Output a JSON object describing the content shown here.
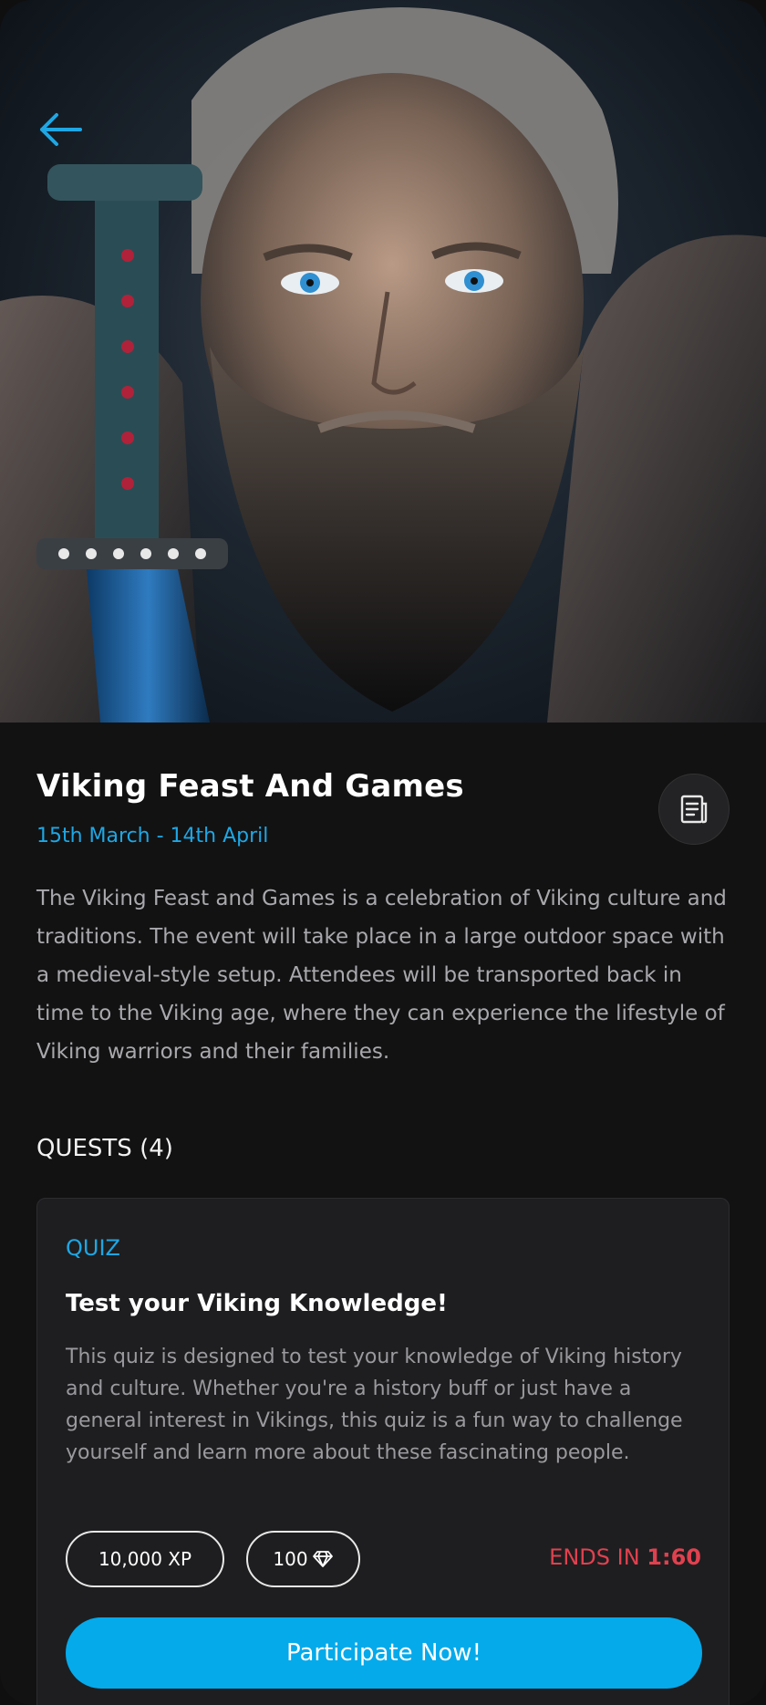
{
  "event": {
    "title": "Viking Feast And Games",
    "dates": "15th March - 14th April",
    "description": "The Viking Feast and Games is a celebration of Viking culture and traditions. The event will take place in a large outdoor space with a medieval-style setup. Attendees will be transported back in time to the Viking age, where they can experience the lifestyle of Viking warriors and their families."
  },
  "quests": {
    "heading": "QUESTS (4)",
    "items": [
      {
        "type": "QUIZ",
        "title": "Test your Viking Knowledge!",
        "description": "This quiz is designed to test your knowledge of Viking history and culture. Whether you're a history buff or just have a general interest in Vikings, this quiz is a fun way to challenge yourself and learn more about these fascinating people.",
        "xp": "10,000 XP",
        "gems": "100",
        "ends_prefix": "ENDS IN",
        "ends_time": "1:60",
        "cta": "Participate Now!"
      }
    ]
  },
  "icons": {
    "back": "arrow-left-icon",
    "document": "document-icon",
    "gem": "diamond-icon"
  },
  "colors": {
    "accent": "#05aaeb",
    "danger": "#e0414f",
    "background": "#121213",
    "card": "#1e1e20"
  }
}
